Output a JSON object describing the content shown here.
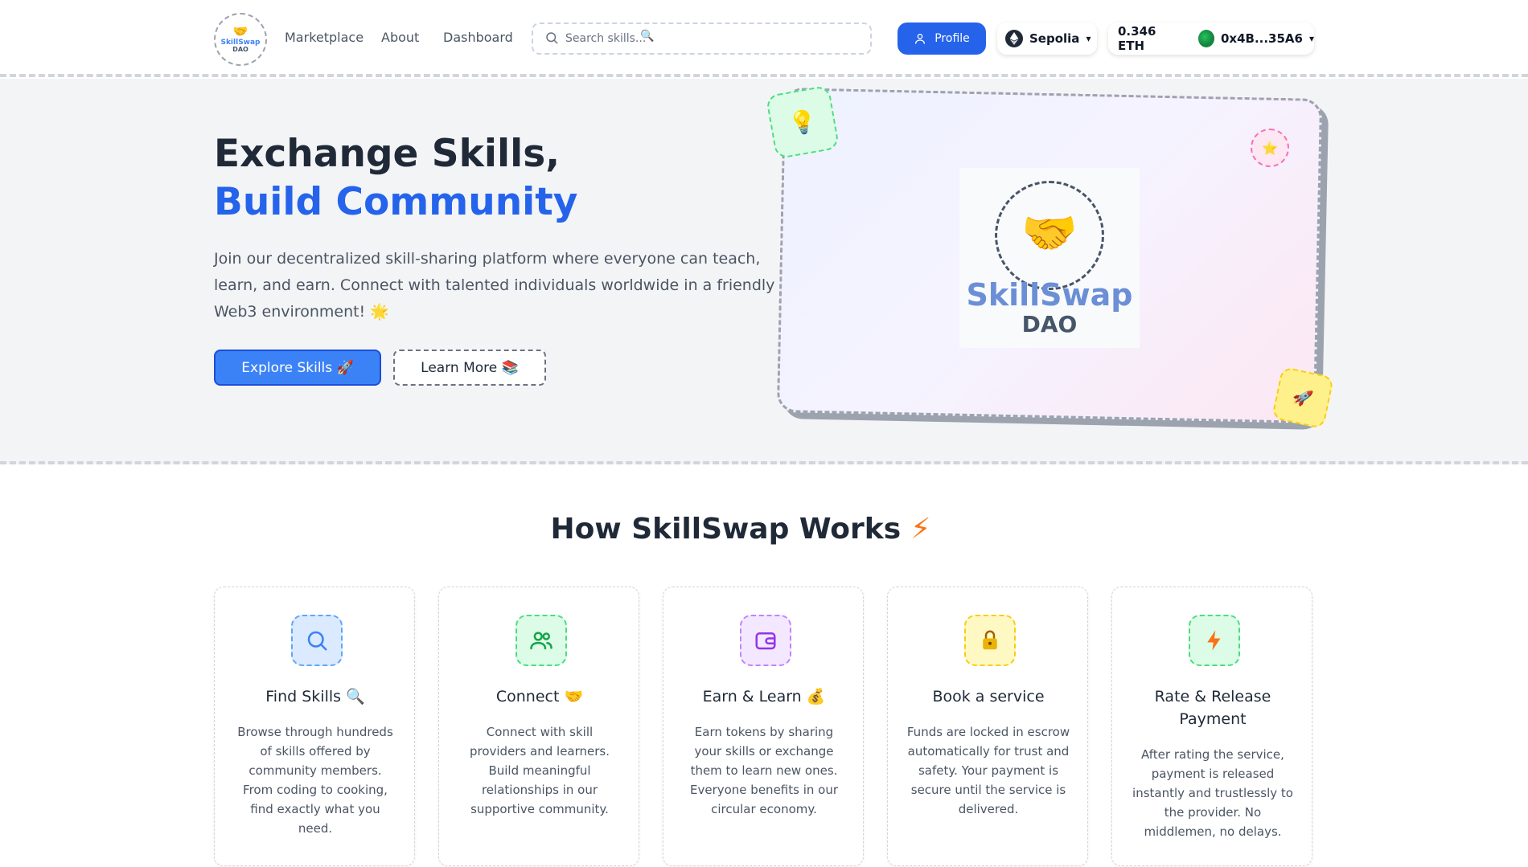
{
  "nav": {
    "logo": {
      "line1": "SkillSwap",
      "line2": "DAO"
    },
    "links": [
      "Marketplace",
      "About",
      "Dashboard"
    ],
    "search_placeholder": "Search skills...",
    "profile_label": "Profile",
    "network": "Sepolia",
    "balance": "0.346 ETH",
    "address": "0x4B...35A6"
  },
  "hero": {
    "title_line1": "Exchange Skills,",
    "title_line2": "Build Community",
    "description": "Join our decentralized skill-sharing platform where everyone can teach, learn, and earn. Connect with talented individuals worldwide in a friendly Web3 environment! 🌟",
    "explore_label": "Explore Skills 🚀",
    "learn_label": "Learn More 📚",
    "logo": {
      "line1": "SkillSwap",
      "line2": "DAO"
    }
  },
  "how": {
    "title": "How SkillSwap Works",
    "title_emoji": "⚡",
    "steps": [
      {
        "title": "Find Skills 🔍",
        "description": "Browse through hundreds of skills offered by community members. From coding to cooking, find exactly what you need.",
        "icon": "search-icon",
        "color": "#3b82f6"
      },
      {
        "title": "Connect 🤝",
        "description": "Connect with skill providers and learners. Build meaningful relationships in our supportive community.",
        "icon": "users-icon",
        "color": "#16a34a"
      },
      {
        "title": "Earn & Learn 💰",
        "description": "Earn tokens by sharing your skills or exchange them to learn new ones. Everyone benefits in our circular economy.",
        "icon": "wallet-icon",
        "color": "#9333ea"
      },
      {
        "title": "Book a service",
        "description": "Funds are locked in escrow automatically for trust and safety. Your payment is secure until the service is delivered.",
        "icon": "lock-icon",
        "color": "#ca8a04"
      },
      {
        "title": "Rate & Release Payment",
        "description": "After rating the service, payment is released instantly and trustlessly to the provider. No middlemen, no delays.",
        "icon": "bolt-icon",
        "color": "#f97316"
      }
    ]
  },
  "colors": {
    "primary": "#2563eb",
    "accent_orange": "#f97316"
  }
}
